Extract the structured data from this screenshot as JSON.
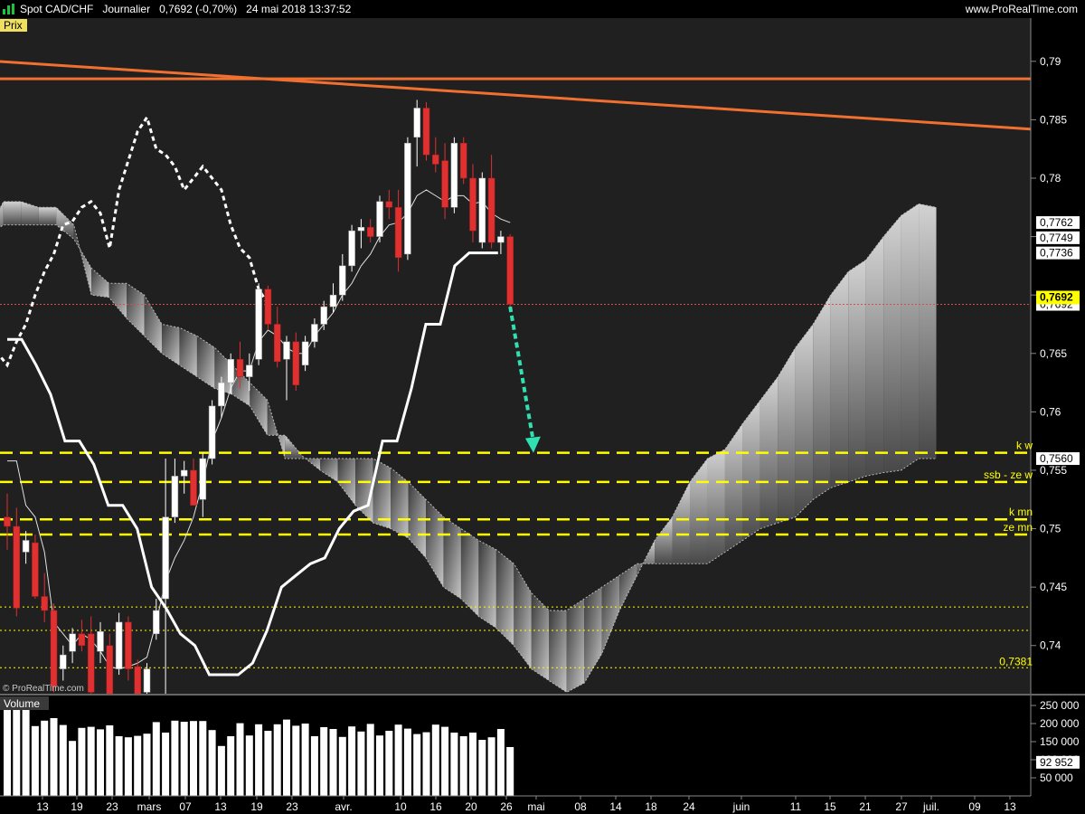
{
  "header": {
    "title_parts": [
      "Spot CAD/CHF",
      "Journalier",
      "0,7692 (-0,70%)",
      "24 mai 2018 13:37:52"
    ],
    "site": "www.ProRealTime.com"
  },
  "price_panel": {
    "label": "Prix",
    "watermark": "© ProRealTime.com"
  },
  "volume_panel": {
    "label": "Volume"
  },
  "colors": {
    "bull": "#ffffff",
    "bear": "#e03030",
    "trend": "#f07030",
    "levels": "#ffff00",
    "arrow": "#30e0b0",
    "current": "#ffff00"
  },
  "chart_data": [
    {
      "type": "candlestick",
      "title": "Spot CAD/CHF",
      "ylabel": "Prix",
      "ylim": [
        0.7358,
        0.7937
      ],
      "y_ticks": [
        0.74,
        0.745,
        0.75,
        0.755,
        0.76,
        0.765,
        0.77,
        0.775,
        0.78,
        0.785,
        0.79
      ],
      "y_tick_labels": [
        "0,74",
        "0,745",
        "0,75",
        "0,755",
        "0,76",
        "0,765",
        "0,77",
        "0,775",
        "0,78",
        "0,785",
        "0,79"
      ],
      "x_ticks": [
        "13",
        "19",
        "23",
        "mars",
        "07",
        "13",
        "19",
        "23",
        "avr.",
        "10",
        "16",
        "20",
        "26",
        "mai",
        "08",
        "14",
        "18",
        "24",
        "juin",
        "11",
        "15",
        "21",
        "27",
        "juil.",
        "09",
        "13"
      ],
      "candles": [
        [
          0.751,
          0.753,
          0.7482,
          0.7502
        ],
        [
          0.7502,
          0.7518,
          0.7425,
          0.7432
        ],
        [
          0.748,
          0.7498,
          0.747,
          0.749
        ],
        [
          0.7488,
          0.7495,
          0.744,
          0.7442
        ],
        [
          0.7442,
          0.7462,
          0.742,
          0.743
        ],
        [
          0.743,
          0.7436,
          0.736,
          0.7365
        ],
        [
          0.738,
          0.74,
          0.737,
          0.7392
        ],
        [
          0.7395,
          0.7415,
          0.7385,
          0.741
        ],
        [
          0.741,
          0.7422,
          0.7395,
          0.74
        ],
        [
          0.741,
          0.7425,
          0.735,
          0.736
        ],
        [
          0.7395,
          0.742,
          0.7385,
          0.7412
        ],
        [
          0.74,
          0.741,
          0.734,
          0.7345
        ],
        [
          0.738,
          0.7428,
          0.7375,
          0.742
        ],
        [
          0.742,
          0.7425,
          0.737,
          0.738
        ],
        [
          0.7382,
          0.7388,
          0.735,
          0.7355
        ],
        [
          0.736,
          0.7385,
          0.7355,
          0.738
        ],
        [
          0.741,
          0.744,
          0.7405,
          0.743
        ],
        [
          0.744,
          0.756,
          0.73,
          0.751
        ],
        [
          0.751,
          0.756,
          0.7505,
          0.7545
        ],
        [
          0.7545,
          0.7558,
          0.753,
          0.755
        ],
        [
          0.755,
          0.756,
          0.752,
          0.752
        ],
        [
          0.7525,
          0.7565,
          0.751,
          0.756
        ],
        [
          0.756,
          0.761,
          0.7555,
          0.7605
        ],
        [
          0.7605,
          0.763,
          0.7595,
          0.7625
        ],
        [
          0.7625,
          0.765,
          0.7615,
          0.7645
        ],
        [
          0.7645,
          0.766,
          0.762,
          0.763
        ],
        [
          0.763,
          0.765,
          0.7618,
          0.764
        ],
        [
          0.7645,
          0.771,
          0.764,
          0.7705
        ],
        [
          0.7705,
          0.7708,
          0.767,
          0.7675
        ],
        [
          0.7675,
          0.769,
          0.7638,
          0.7643
        ],
        [
          0.7645,
          0.7665,
          0.761,
          0.766
        ],
        [
          0.766,
          0.7668,
          0.7618,
          0.7623
        ],
        [
          0.764,
          0.7665,
          0.7635,
          0.766
        ],
        [
          0.766,
          0.768,
          0.7655,
          0.7675
        ],
        [
          0.7675,
          0.7695,
          0.767,
          0.769
        ],
        [
          0.769,
          0.771,
          0.7685,
          0.77
        ],
        [
          0.77,
          0.7735,
          0.7695,
          0.7725
        ],
        [
          0.7725,
          0.776,
          0.772,
          0.7755
        ],
        [
          0.7755,
          0.7765,
          0.774,
          0.7758
        ],
        [
          0.7758,
          0.7765,
          0.7745,
          0.775
        ],
        [
          0.775,
          0.7785,
          0.7745,
          0.778
        ],
        [
          0.778,
          0.779,
          0.7765,
          0.7775
        ],
        [
          0.7775,
          0.779,
          0.772,
          0.7732
        ],
        [
          0.7735,
          0.7835,
          0.773,
          0.783
        ],
        [
          0.7835,
          0.7867,
          0.781,
          0.786
        ],
        [
          0.786,
          0.7865,
          0.7815,
          0.782
        ],
        [
          0.782,
          0.7835,
          0.7805,
          0.7812
        ],
        [
          0.7815,
          0.783,
          0.7765,
          0.7775
        ],
        [
          0.7775,
          0.7835,
          0.777,
          0.783
        ],
        [
          0.783,
          0.7835,
          0.7795,
          0.78
        ],
        [
          0.78,
          0.7812,
          0.7745,
          0.7755
        ],
        [
          0.7745,
          0.7805,
          0.774,
          0.78
        ],
        [
          0.78,
          0.782,
          0.774,
          0.7745
        ],
        [
          0.7745,
          0.7755,
          0.7735,
          0.775
        ],
        [
          0.775,
          0.7752,
          0.769,
          0.7692
        ]
      ],
      "volumes": [
        238000,
        248000,
        248000,
        193000,
        208000,
        215000,
        196000,
        152000,
        188000,
        191000,
        184000,
        195000,
        165000,
        162000,
        166000,
        172000,
        204000,
        175000,
        208000,
        205000,
        207000,
        207000,
        182000,
        138000,
        165000,
        201000,
        167000,
        198000,
        180000,
        198000,
        211000,
        194000,
        200000,
        165000,
        190000,
        185000,
        163000,
        192000,
        178000,
        199000,
        167000,
        180000,
        197000,
        186000,
        171000,
        176000,
        197000,
        191000,
        175000,
        165000,
        175000,
        155000,
        162000,
        185000,
        135000
      ],
      "tenkan": [
        0.7558,
        0.7558,
        0.752,
        0.751,
        0.748,
        0.742,
        0.741,
        0.74,
        0.741,
        0.7405,
        0.7395,
        0.7382,
        0.738,
        0.7382,
        0.7385,
        0.739,
        0.742,
        0.7455,
        0.7475,
        0.749,
        0.751,
        0.754,
        0.7575,
        0.7595,
        0.762,
        0.7635,
        0.7635,
        0.766,
        0.767,
        0.7665,
        0.7655,
        0.765,
        0.765,
        0.7665,
        0.7675,
        0.7685,
        0.77,
        0.771,
        0.7725,
        0.7735,
        0.775,
        0.776,
        0.7762,
        0.777,
        0.7785,
        0.779,
        0.7785,
        0.778,
        0.7785,
        0.7785,
        0.7778,
        0.778,
        0.777,
        0.7765,
        0.7762
      ],
      "kijun": {
        "values": [
          0.7662,
          0.7662,
          0.764,
          0.7615,
          0.7575,
          0.7575,
          0.7555,
          0.752,
          0.752,
          0.75,
          0.745,
          0.7432,
          0.741,
          0.74,
          0.7375,
          0.7375,
          0.7375,
          0.7385,
          0.7413,
          0.745,
          0.746,
          0.747,
          0.7475,
          0.75,
          0.7515,
          0.752,
          0.7575,
          0.7575,
          0.762,
          0.7675,
          0.7675,
          0.7725,
          0.7736,
          0.7736,
          0.7736
        ],
        "start_index": 0,
        "step_days": 1.55
      },
      "chikou": [
        0.7545,
        0.756,
        0.758,
        0.76,
        0.762,
        0.7635,
        0.764,
        0.765,
        0.764,
        0.766,
        0.7675,
        0.77,
        0.772,
        0.7735,
        0.776,
        0.7763,
        0.7775,
        0.778,
        0.777,
        0.774,
        0.779,
        0.7815,
        0.784,
        0.7852,
        0.7825,
        0.782,
        0.781,
        0.779,
        0.78,
        0.781,
        0.78,
        0.779,
        0.776,
        0.774,
        0.7732,
        0.7705,
        0.7692
      ],
      "cloud_span_a": [
        0.775,
        0.778,
        0.778,
        0.7775,
        0.7775,
        0.776,
        0.77,
        0.7698,
        0.768,
        0.7665,
        0.765,
        0.764,
        0.763,
        0.762,
        0.7615,
        0.7605,
        0.758,
        0.758,
        0.7562,
        0.755,
        0.754,
        0.752,
        0.7505,
        0.75,
        0.7492,
        0.7475,
        0.745,
        0.744,
        0.7425,
        0.7415,
        0.74,
        0.738,
        0.737,
        0.736,
        0.7368,
        0.7393,
        0.743,
        0.746,
        0.749,
        0.751,
        0.754,
        0.756,
        0.7568,
        0.759,
        0.761,
        0.763,
        0.7655,
        0.7675,
        0.77,
        0.772,
        0.773,
        0.775,
        0.7768,
        0.7778,
        0.7775
      ],
      "cloud_span_b": [
        0.775,
        0.776,
        0.776,
        0.776,
        0.776,
        0.7748,
        0.7723,
        0.771,
        0.771,
        0.77,
        0.7675,
        0.7672,
        0.7665,
        0.7655,
        0.764,
        0.7625,
        0.761,
        0.756,
        0.756,
        0.756,
        0.756,
        0.756,
        0.756,
        0.7552,
        0.754,
        0.7525,
        0.751,
        0.75,
        0.749,
        0.7482,
        0.747,
        0.7445,
        0.743,
        0.743,
        0.744,
        0.745,
        0.746,
        0.747,
        0.747,
        0.747,
        0.747,
        0.747,
        0.748,
        0.749,
        0.75,
        0.7505,
        0.751,
        0.7525,
        0.7535,
        0.754,
        0.7545,
        0.7548,
        0.755,
        0.756,
        0.756
      ],
      "trendlines": [
        {
          "points": [
            [
              0,
              0.79
            ],
            [
              57,
              0.7842
            ]
          ]
        },
        {
          "points": [
            [
              0,
              0.7885
            ],
            [
              57,
              0.7885
            ]
          ]
        }
      ],
      "levels": [
        {
          "value": 0.7565,
          "label": "k w",
          "style": "dashed-thick"
        },
        {
          "value": 0.754,
          "label": "ssb - ze w",
          "style": "dashed-thick"
        },
        {
          "value": 0.7508,
          "label": "k mn",
          "style": "dashed-thick"
        },
        {
          "value": 0.7495,
          "label": "ze mn",
          "style": "dashed-thick"
        },
        {
          "value": 0.7433,
          "label": "",
          "style": "dotted"
        },
        {
          "value": 0.7413,
          "label": "",
          "style": "dotted"
        },
        {
          "value": 0.7381,
          "label": "0,7381",
          "style": "dotted"
        }
      ],
      "current_price": {
        "value": 0.7692,
        "label": "0,7692"
      },
      "price_labels": [
        {
          "value": 0.7762,
          "label": "0,7762"
        },
        {
          "value": 0.7749,
          "label": "0,7749"
        },
        {
          "value": 0.7736,
          "label": "0,7736"
        },
        {
          "value": 0.7692,
          "label": "0,7692"
        },
        {
          "value": 0.756,
          "label": "0,7560"
        }
      ],
      "arrow": {
        "from": [
          54,
          0.769
        ],
        "to": [
          56.5,
          0.7565
        ]
      }
    },
    {
      "type": "bar",
      "title": "Volume",
      "ylim": [
        0,
        275000
      ],
      "y_ticks": [
        50000,
        100000,
        150000,
        200000,
        250000
      ],
      "y_tick_labels": [
        "50 000",
        "100 000",
        "150 000",
        "200 000",
        "250 000"
      ],
      "last_value": {
        "value": 92952,
        "label": "92 952"
      }
    }
  ]
}
